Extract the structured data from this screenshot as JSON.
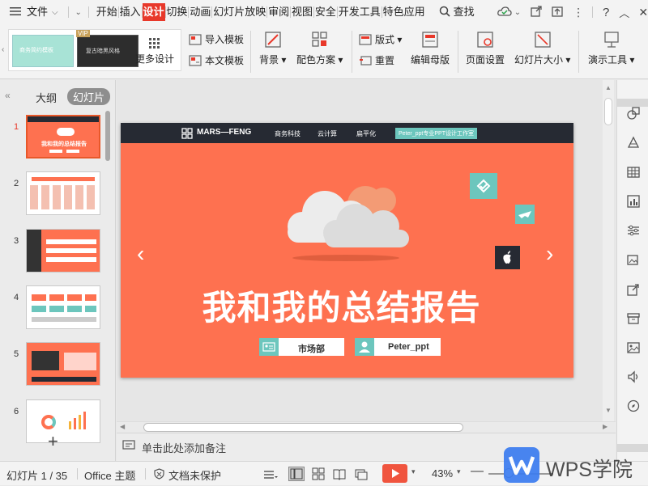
{
  "menu": {
    "file": "文件",
    "tabs": [
      "开始",
      "插入",
      "设计",
      "切换",
      "动画",
      "幻灯片放映",
      "审阅",
      "视图",
      "安全",
      "开发工具",
      "特色应用"
    ],
    "active_tab": "设计",
    "search": "查找"
  },
  "ribbon": {
    "template_thumb1_text": "商务简约模板",
    "template_thumb2_text": "复古暗黑风格",
    "vip_badge": "VIP",
    "more_design": "更多设计",
    "import_template": "导入模板",
    "text_template": "本文模板",
    "background": "背景",
    "color_scheme": "配色方案",
    "layout": "版式",
    "reset": "重置",
    "edit_master": "编辑母版",
    "page_setup": "页面设置",
    "slide_size": "幻灯片大小",
    "presentation_tools": "演示工具"
  },
  "left_pane": {
    "tab_outline": "大纲",
    "tab_slides": "幻灯片",
    "slide_numbers": [
      "1",
      "2",
      "3",
      "4",
      "5",
      "6"
    ],
    "thumb1_title": "我和我的总结报告",
    "add_slide": "+"
  },
  "slide": {
    "brand": "MARS—FENG",
    "nav": [
      "商务科技",
      "云计算",
      "扁平化"
    ],
    "nav_highlight": "Peter_ppt专业PPT设计工作室",
    "title": "我和我的总结报告",
    "dept": "市场部",
    "author": "Peter_ppt",
    "prev_arrow": "‹",
    "next_arrow": "›"
  },
  "notes": {
    "placeholder": "单击此处添加备注"
  },
  "status": {
    "slide_count": "幻灯片 1 / 35",
    "theme": "Office 主题",
    "protection": "文档未保护",
    "zoom": "43%",
    "watermark": "WPS学院"
  },
  "colors": {
    "accent_red": "#e8382a",
    "slide_orange": "#fe7150",
    "navbar_dark": "#262a33",
    "teal": "#6cc6bd"
  }
}
